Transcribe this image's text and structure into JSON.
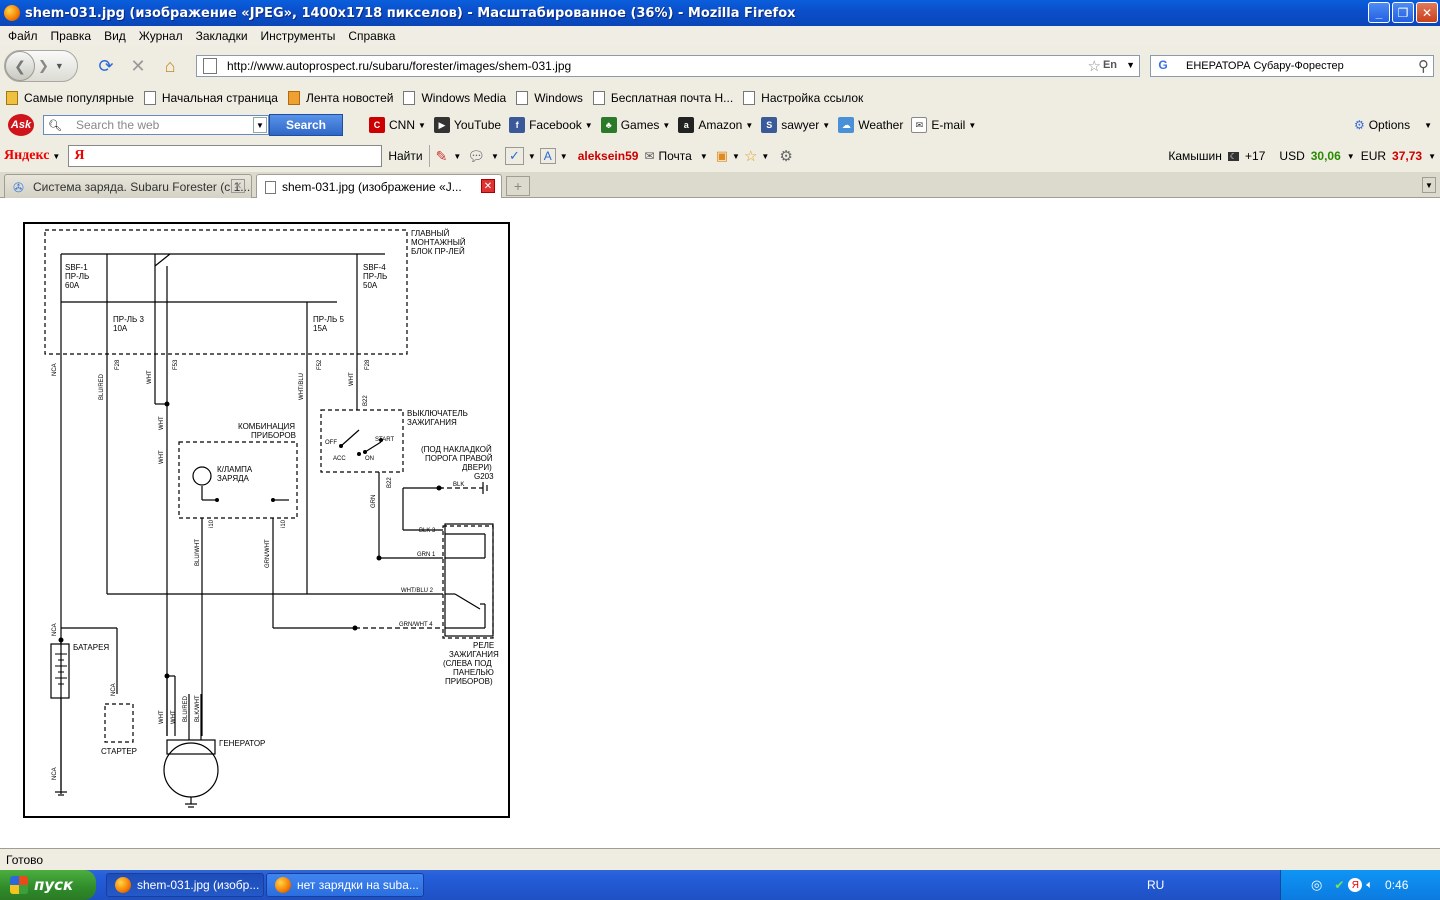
{
  "window": {
    "title": "shem-031.jpg (изображение «JPEG», 1400x1718 пикселов) - Масштабированное (36%) - Mozilla Firefox",
    "min": "_",
    "max": "❐",
    "close": "✕"
  },
  "menu": [
    "Файл",
    "Правка",
    "Вид",
    "Журнал",
    "Закладки",
    "Инструменты",
    "Справка"
  ],
  "nav": {
    "url": "http://www.autoprospect.ru/subaru/forester/images/shem-031.jpg",
    "search_text": "ЕНЕРАТОРА  Субару-Форестер",
    "lang_badge": "En"
  },
  "bookmarks": [
    "Самые популярные",
    "Начальная страница",
    "Лента новостей",
    "Windows Media",
    "Windows",
    "Бесплатная почта H...",
    "Настройка ссылок"
  ],
  "ask": {
    "logo": "Ask",
    "placeholder": "Search the web",
    "search_btn": "Search",
    "items": [
      "CNN",
      "YouTube",
      "Facebook",
      "Games",
      "Amazon",
      "sawyer",
      "Weather",
      "E-mail"
    ],
    "options": "Options"
  },
  "yandex": {
    "logo": "Яндекс",
    "input_logo": "Я",
    "find": "Найти",
    "user": "aleksein59",
    "mail": "Почта",
    "city": "Камышин",
    "temp": "+17",
    "usd_label": "USD",
    "usd": "30,06",
    "eur_label": "EUR",
    "eur": "37,73"
  },
  "tabs": [
    {
      "label": "Система заряда. Subaru Forester (с 1..."
    },
    {
      "label": "shem-031.jpg (изображение «J..."
    }
  ],
  "diagram": {
    "main_block": [
      "ГЛАВНЫЙ",
      "МОНТАЖНЫЙ",
      "БЛОК ПР-ЛЕЙ"
    ],
    "sbf1": [
      "SBF-1",
      "ПР-ЛЬ",
      "60A"
    ],
    "sbf4": [
      "SBF-4",
      "ПР-ЛЬ",
      "50A"
    ],
    "fuse3": [
      "ПР-ЛЬ 3",
      "10A"
    ],
    "fuse5": [
      "ПР-ЛЬ 5",
      "15A"
    ],
    "ignition_switch": [
      "ВЫКЛЮЧАТЕЛЬ",
      "ЗАЖИГАНИЯ"
    ],
    "ign_positions": [
      "OFF",
      "ACC",
      "ON",
      "START"
    ],
    "ground_note": [
      "(ПОД НАКЛАДКОЙ",
      "ПОРОГА ПРАВОЙ",
      "ДВЕРИ)",
      "G203"
    ],
    "cluster": [
      "КОМБИНАЦИЯ",
      "ПРИБОРОВ"
    ],
    "lamp": [
      "К/ЛАМПА",
      "ЗАРЯДА"
    ],
    "relay": [
      "РЕЛЕ",
      "ЗАЖИГАНИЯ",
      "(СЛЕВА ПОД",
      "ПАНЕЛЬЮ",
      "ПРИБОРОВ)"
    ],
    "battery": "БАТАРЕЯ",
    "starter": "СТАРТЕР",
    "generator": "ГЕНЕРАТОР",
    "wires": {
      "blk": "BLK",
      "grn": "GRN",
      "wht": "WHT",
      "wht_blu": "WHT/BLU",
      "blu_red": "BLU/RED",
      "blu_wht": "BLU/WHT",
      "grn_wht": "GRN/WHT",
      "blk_wht": "BLK/WHT",
      "nca": "NCA"
    },
    "relay_pins": {
      "p3": "BLK 3",
      "p1": "GRN 1",
      "p2": "WHT/BLU 2",
      "p4": "GRN/WHT 4"
    },
    "connectors": {
      "f28": "F28",
      "f53": "F53",
      "f52": "F52",
      "b22": "B22",
      "i10": "i10"
    }
  },
  "status": "Готово",
  "taskbar": {
    "start": "пуск",
    "tasks": [
      "shem-031.jpg (изобр...",
      "нет зарядки на suba..."
    ],
    "lang": "RU",
    "clock": "0:46"
  }
}
